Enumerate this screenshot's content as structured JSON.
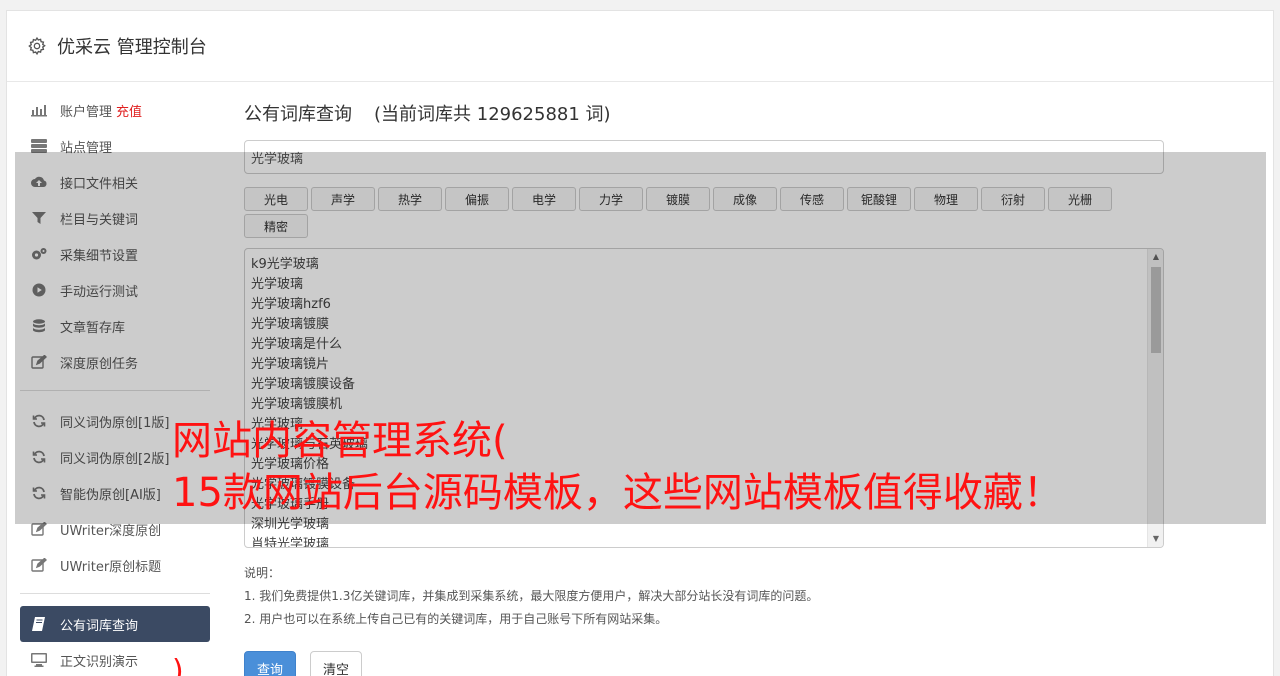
{
  "header": {
    "title": "优采云 管理控制台",
    "icon": "gear-icon"
  },
  "sidebar": {
    "items": [
      {
        "label": "账户管理",
        "badge": "充值",
        "icon": "bar-chart-icon"
      },
      {
        "label": "站点管理",
        "icon": "server-icon"
      },
      {
        "label": "接口文件相关",
        "icon": "cloud-upload-icon"
      },
      {
        "label": "栏目与关键词",
        "icon": "filter-icon"
      },
      {
        "label": "采集细节设置",
        "icon": "gears-icon"
      },
      {
        "label": "手动运行测试",
        "icon": "play-circle-icon"
      },
      {
        "label": "文章暂存库",
        "icon": "database-icon"
      },
      {
        "label": "深度原创任务",
        "icon": "edit-icon"
      }
    ],
    "items2": [
      {
        "label": "同义词伪原创[1版]",
        "icon": "refresh-icon"
      },
      {
        "label": "同义词伪原创[2版]",
        "icon": "refresh-icon"
      },
      {
        "label": "智能伪原创[AI版]",
        "icon": "refresh-icon"
      },
      {
        "label": "UWriter深度原创",
        "icon": "edit-icon"
      },
      {
        "label": "UWriter原创标题",
        "icon": "edit-icon"
      }
    ],
    "items3": [
      {
        "label": "公有词库查询",
        "icon": "book-icon"
      },
      {
        "label": "正文识别演示",
        "icon": "monitor-icon"
      }
    ]
  },
  "main": {
    "title": "公有词库查询",
    "count_text": "(当前词库共 129625881 词)",
    "search_value": "光学玻璃",
    "tags": [
      "光电",
      "声学",
      "热学",
      "偏振",
      "电学",
      "力学",
      "镀膜",
      "成像",
      "传感",
      "铌酸锂",
      "物理",
      "衍射",
      "光栅",
      "精密"
    ],
    "words": [
      "k9光学玻璃",
      "光学玻璃",
      "光学玻璃hzf6",
      "光学玻璃镀膜",
      "光学玻璃是什么",
      "光学玻璃镜片",
      "光学玻璃镀膜设备",
      "光学玻璃镀膜机",
      "光学玻璃",
      "光学玻璃与石英玻璃",
      "光学玻璃价格",
      "光学玻璃镀膜设备",
      "光学玻璃手册",
      "深圳光学玻璃",
      "肖特光学玻璃"
    ],
    "notes_title": "说明：",
    "notes": [
      "1. 我们免费提供1.3亿关键词库，并集成到采集系统，最大限度方便用户，解决大部分站长没有词库的问题。",
      "2. 用户也可以在系统上传自己已有的关键词库，用于自己账号下所有网站采集。"
    ],
    "query_button": "查询",
    "clear_button": "清空"
  },
  "overlay": {
    "line1": "网站内容管理系统(",
    "line2": "15款网站后台源码模板，这些网站模板值得收藏！",
    "mark": ")"
  }
}
